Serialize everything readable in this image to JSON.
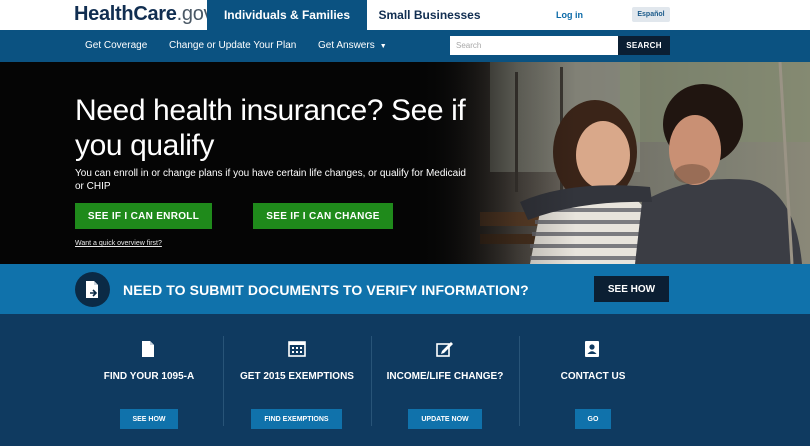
{
  "header": {
    "logo_main": "HealthCare",
    "logo_suffix": ".gov",
    "tabs": [
      {
        "label": "Individuals & Families"
      },
      {
        "label": "Small Businesses"
      }
    ],
    "login": "Log in",
    "language": "Español"
  },
  "nav": {
    "items": [
      {
        "label": "Get Coverage"
      },
      {
        "label": "Change or Update Your Plan"
      },
      {
        "label": "Get Answers"
      }
    ],
    "search_placeholder": "Search",
    "search_button": "SEARCH"
  },
  "hero": {
    "title": "Need health insurance? See if you qualify",
    "subtitle": "You can enroll in or change plans if you have certain life changes, or qualify for Medicaid or CHIP",
    "enroll_button": "SEE IF I CAN ENROLL",
    "change_button": "SEE IF I CAN CHANGE",
    "overview_link": "Want a quick overview first?"
  },
  "documents_banner": {
    "text": "NEED TO SUBMIT DOCUMENTS TO VERIFY INFORMATION?",
    "button": "SEE HOW",
    "icon": "document-upload-icon"
  },
  "cards": [
    {
      "title": "FIND YOUR 1095-A",
      "button": "SEE HOW",
      "icon": "document-icon"
    },
    {
      "title": "GET 2015 EXEMPTIONS",
      "button": "FIND EXEMPTIONS",
      "icon": "calendar-icon"
    },
    {
      "title": "INCOME/LIFE CHANGE?",
      "button": "UPDATE NOW",
      "icon": "edit-icon"
    },
    {
      "title": "CONTACT US",
      "button": "GO",
      "icon": "contact-book-icon"
    }
  ],
  "colors": {
    "brand_navy": "#112e51",
    "nav_blue": "#0b5281",
    "action_green": "#1f8a1b",
    "banner_blue": "#1072ab",
    "footer_navy": "#0f3a60"
  }
}
